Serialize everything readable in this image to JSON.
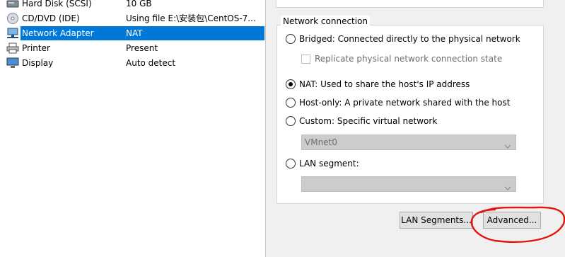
{
  "colors": {
    "selection": "#0078d7",
    "annotation": "#e3150d"
  },
  "devices": [
    {
      "icon": "hard-disk-icon",
      "name": "Hard Disk (SCSI)",
      "summary": "10 GB",
      "selected": false
    },
    {
      "icon": "cd-dvd-icon",
      "name": "CD/DVD (IDE)",
      "summary": "Using file E:\\安装包\\CentOS-7...",
      "selected": false
    },
    {
      "icon": "network-adapter-icon",
      "name": "Network Adapter",
      "summary": "NAT",
      "selected": true
    },
    {
      "icon": "printer-icon",
      "name": "Printer",
      "summary": "Present",
      "selected": false
    },
    {
      "icon": "display-icon",
      "name": "Display",
      "summary": "Auto detect",
      "selected": false
    }
  ],
  "network_connection": {
    "title": "Network connection",
    "bridged": "Bridged: Connected directly to the physical network",
    "replicate": "Replicate physical network connection state",
    "replicate_checked": false,
    "nat": "NAT: Used to share the host's IP address",
    "host_only": "Host-only: A private network shared with the host",
    "custom": "Custom: Specific virtual network",
    "custom_value": "VMnet0",
    "lan_segment": "LAN segment:",
    "lan_segment_value": "",
    "selected": "nat"
  },
  "buttons": {
    "lan_segments": "LAN Segments...",
    "advanced": "Advanced..."
  }
}
